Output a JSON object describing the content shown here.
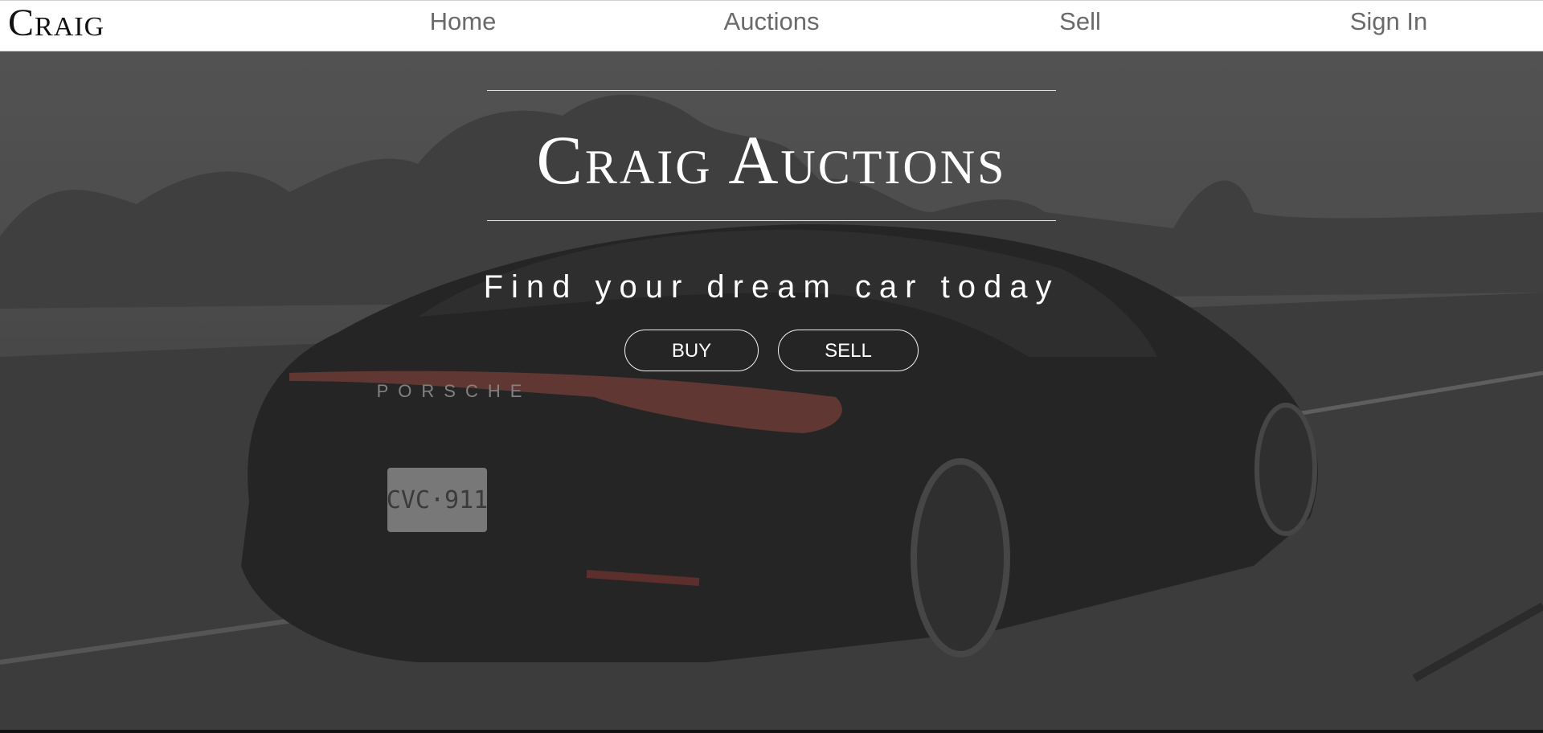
{
  "navbar": {
    "brand": "Craig",
    "links": [
      {
        "label": "Home"
      },
      {
        "label": "Auctions"
      },
      {
        "label": "Sell"
      },
      {
        "label": "Sign In"
      }
    ]
  },
  "hero": {
    "title": "Craig Auctions",
    "subtitle": "Find your dream car today",
    "buttons": {
      "buy": "BUY",
      "sell": "SELL"
    },
    "car": {
      "brand_lettering": "PORSCHE",
      "plate": "CVC·911"
    }
  }
}
